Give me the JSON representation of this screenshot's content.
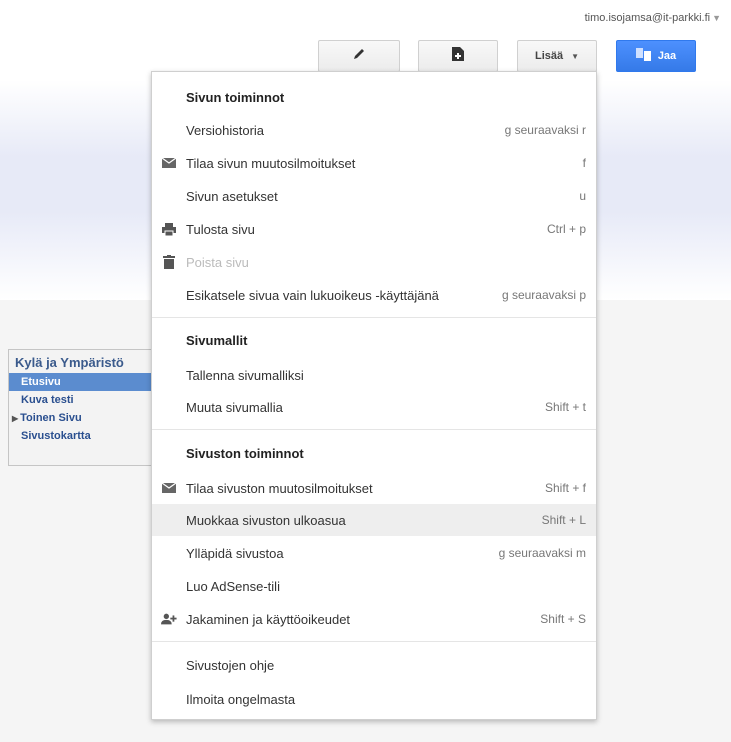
{
  "header": {
    "account_email": "timo.isojamsa@it-parkki.fi",
    "more_label": "Lisää",
    "share_label": "Jaa"
  },
  "site_nav": {
    "title": "Kylä ja Ympäristö",
    "items": [
      {
        "label": "Etusivu",
        "active": true
      },
      {
        "label": "Kuva testi"
      },
      {
        "label": "Toinen Sivu",
        "expandable": true
      },
      {
        "label": "Sivustokartta"
      }
    ]
  },
  "menu": {
    "section1": {
      "title": "Sivun toiminnot",
      "items": [
        {
          "label": "Versiohistoria",
          "shortcut": "g seuraavaksi r"
        },
        {
          "label": "Tilaa sivun muutosilmoitukset",
          "shortcut": "f",
          "icon": "mail-icon"
        },
        {
          "label": "Sivun asetukset",
          "shortcut": "u"
        },
        {
          "label": "Tulosta sivu",
          "shortcut": "Ctrl + p",
          "icon": "print-icon"
        },
        {
          "label": "Poista sivu",
          "shortcut": "",
          "icon": "trash-icon",
          "disabled": true
        },
        {
          "label": "Esikatsele sivua vain lukuoikeus -käyttäjänä",
          "shortcut": "g seuraavaksi p"
        }
      ]
    },
    "section2": {
      "title": "Sivumallit",
      "items": [
        {
          "label": "Tallenna sivumalliksi",
          "shortcut": ""
        },
        {
          "label": "Muuta sivumallia",
          "shortcut": "Shift + t"
        }
      ]
    },
    "section3": {
      "title": "Sivuston toiminnot",
      "items": [
        {
          "label": "Tilaa sivuston muutosilmoitukset",
          "shortcut": "Shift + f",
          "icon": "mail-icon"
        },
        {
          "label": "Muokkaa sivuston ulkoasua",
          "shortcut": "Shift + L",
          "highlighted": true
        },
        {
          "label": "Ylläpidä sivustoa",
          "shortcut": "g seuraavaksi m"
        },
        {
          "label": "Luo AdSense-tili",
          "shortcut": ""
        },
        {
          "label": "Jakaminen ja käyttöoikeudet",
          "shortcut": "Shift + S",
          "icon": "add-person-icon"
        }
      ]
    },
    "section4": {
      "items": [
        {
          "label": "Sivustojen ohje"
        },
        {
          "label": "Ilmoita ongelmasta"
        }
      ]
    }
  },
  "colors": {
    "accent": "#4d90fe",
    "highlight": "#eeeeee",
    "nav_active": "#5b8ccf"
  }
}
